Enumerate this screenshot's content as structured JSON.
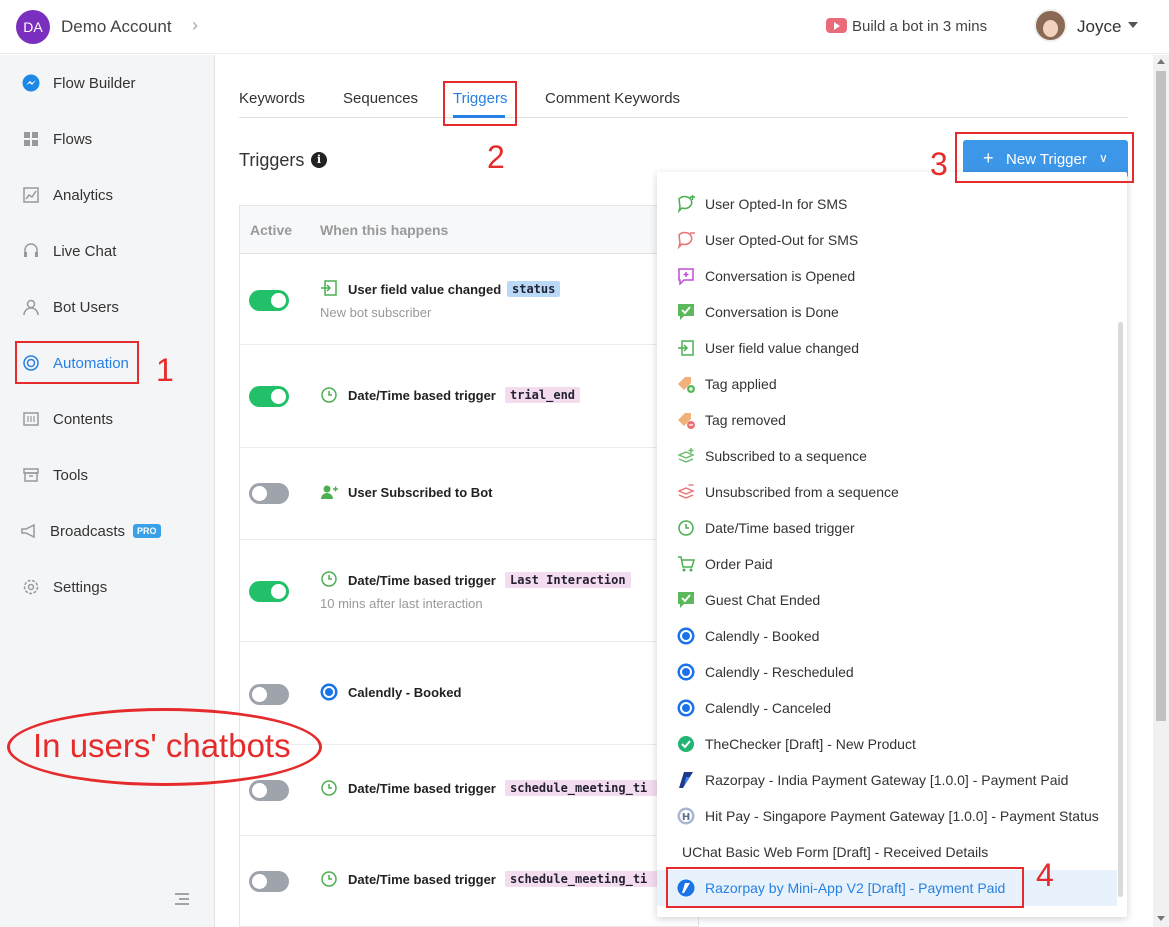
{
  "account": {
    "initials": "DA",
    "name": "Demo Account"
  },
  "header": {
    "video_label": "Build a bot in 3 mins",
    "user_name": "Joyce"
  },
  "sidebar": {
    "items": [
      {
        "label": "Flow Builder",
        "icon": "messenger-icon"
      },
      {
        "label": "Flows",
        "icon": "grid-icon"
      },
      {
        "label": "Analytics",
        "icon": "chart-icon"
      },
      {
        "label": "Live Chat",
        "icon": "headset-icon"
      },
      {
        "label": "Bot Users",
        "icon": "user-icon"
      },
      {
        "label": "Automation",
        "icon": "automation-icon"
      },
      {
        "label": "Contents",
        "icon": "contents-icon"
      },
      {
        "label": "Tools",
        "icon": "archive-icon"
      },
      {
        "label": "Broadcasts",
        "icon": "megaphone-icon"
      },
      {
        "label": "Settings",
        "icon": "gear-icon"
      }
    ],
    "pro_badge": "PRO",
    "active": "Automation"
  },
  "tabs": [
    "Keywords",
    "Sequences",
    "Triggers",
    "Comment Keywords"
  ],
  "active_tab": "Triggers",
  "page_title": "Triggers",
  "new_trigger_label": "New Trigger",
  "table": {
    "headers": {
      "active": "Active",
      "when": "When this happens"
    },
    "rows": [
      {
        "on": true,
        "title": "User field value changed",
        "tag": "status",
        "sub": "New bot subscriber"
      },
      {
        "on": true,
        "title": "Date/Time based trigger",
        "tag": "trial_end",
        "sub": ""
      },
      {
        "on": false,
        "title": "User Subscribed to Bot",
        "tag": "",
        "sub": ""
      },
      {
        "on": true,
        "title": "Date/Time based trigger",
        "tag": "Last Interaction",
        "sub": "10 mins after last interaction"
      },
      {
        "on": false,
        "title": "Calendly - Booked",
        "tag": "",
        "sub": ""
      },
      {
        "on": false,
        "title": "Date/Time based trigger",
        "tag": "schedule_meeting_ti",
        "sub": ""
      },
      {
        "on": false,
        "title": "Date/Time based trigger",
        "tag": "schedule_meeting_ti",
        "sub": ""
      }
    ]
  },
  "dropdown": {
    "items": [
      "User Opted-In for SMS",
      "User Opted-Out for SMS",
      "Conversation is Opened",
      "Conversation is Done",
      "User field value changed",
      "Tag applied",
      "Tag removed",
      "Subscribed to a sequence",
      "Unsubscribed from a sequence",
      "Date/Time based trigger",
      "Order Paid",
      "Guest Chat Ended",
      "Calendly - Booked",
      "Calendly - Rescheduled",
      "Calendly - Canceled",
      "TheChecker [Draft] - New Product",
      "Razorpay - India Payment Gateway [1.0.0] - Payment Paid",
      "Hit Pay - Singapore Payment Gateway [1.0.0] - Payment Status",
      "UChat Basic Web Form [Draft] - Received Details",
      "Razorpay by Mini-App V2 [Draft] - Payment Paid"
    ]
  },
  "annotations": {
    "n1": "1",
    "n2": "2",
    "n3": "3",
    "n4": "4",
    "callout": "In users' chatbots"
  },
  "colors": {
    "accent": "#2780e3",
    "annotation": "#e52b2b",
    "toggle_on": "#23c06a"
  }
}
